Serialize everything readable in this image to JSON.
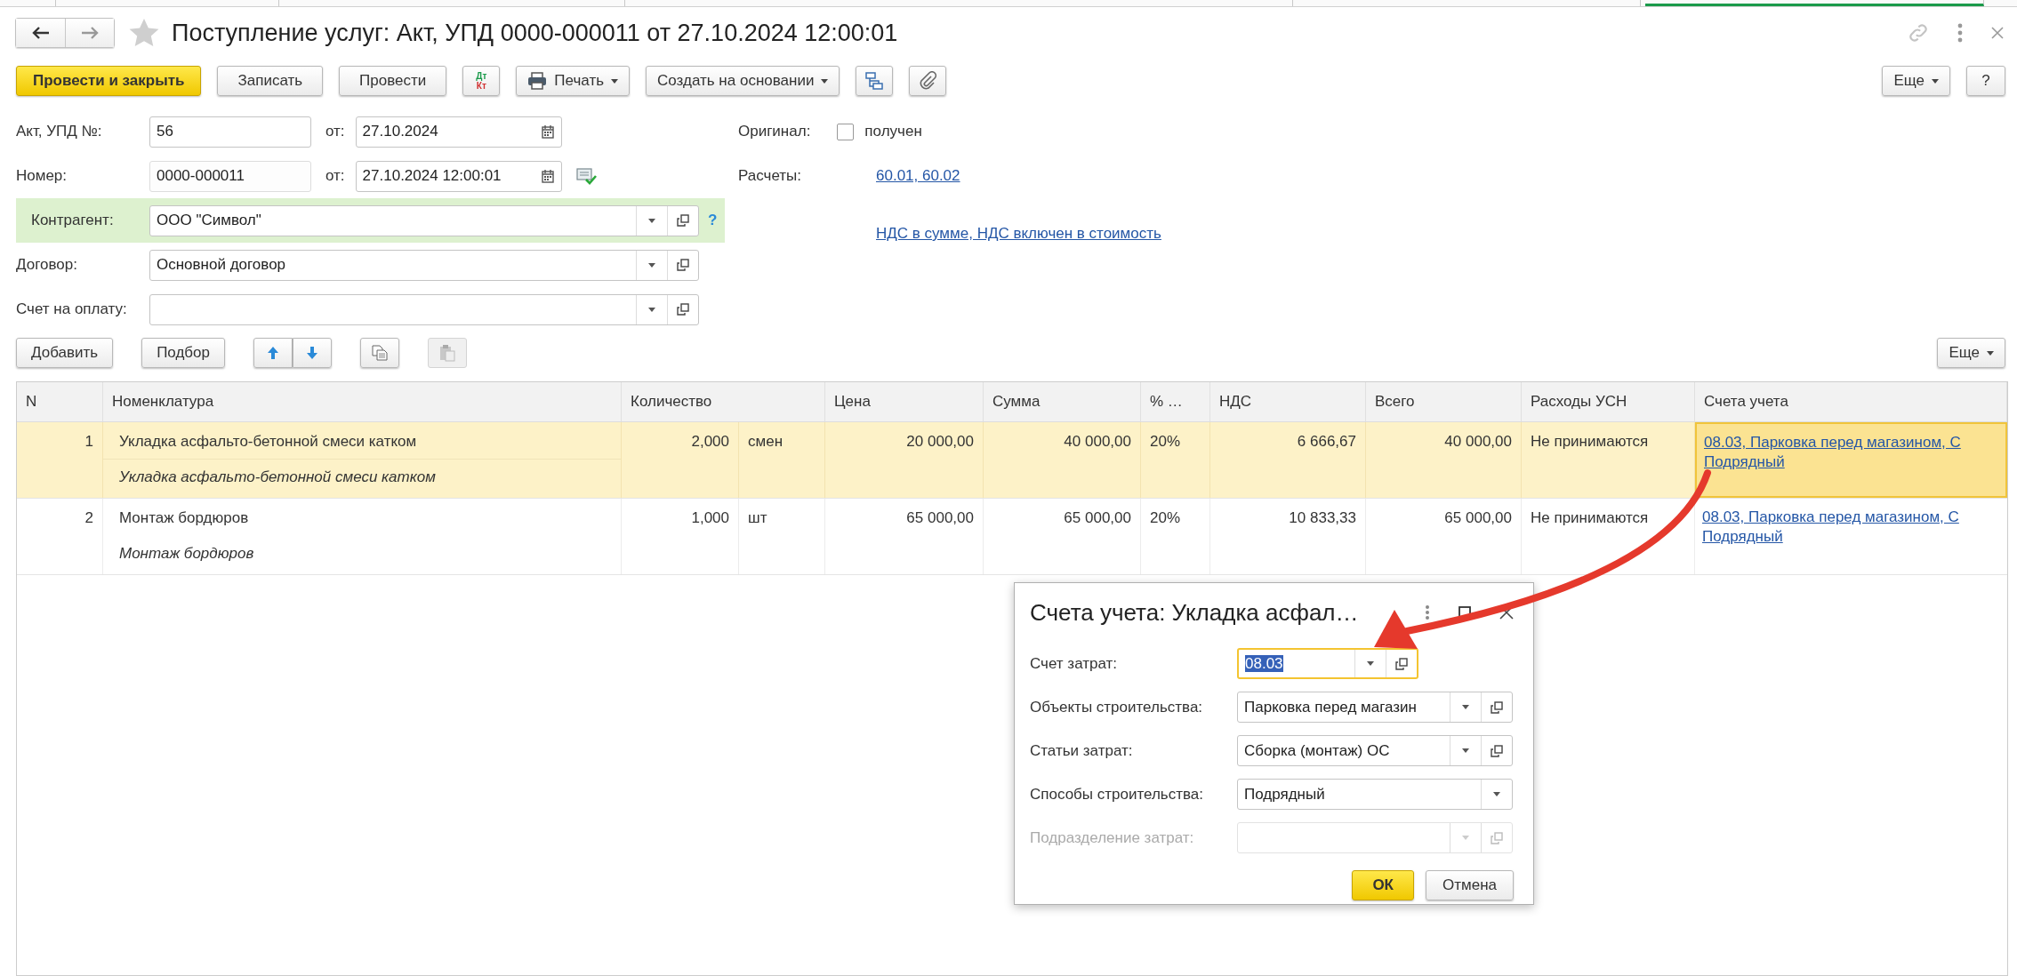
{
  "window": {
    "title": "Поступление услуг: Акт, УПД 0000-000011 от 27.10.2024 12:00:01",
    "favorite": false
  },
  "toolbar": {
    "items": [
      {
        "kind": "primary",
        "label": "Провести и закрыть"
      },
      {
        "kind": "button",
        "label": "Записать"
      },
      {
        "kind": "button",
        "label": "Провести"
      },
      {
        "kind": "dtkt",
        "label_top": "Дт",
        "label_bottom": "Кт"
      },
      {
        "kind": "print",
        "label": "Печать"
      },
      {
        "kind": "dropdown",
        "label": "Создать на основании"
      },
      {
        "kind": "structure"
      },
      {
        "kind": "attach"
      }
    ],
    "more": "Еще",
    "help": "?"
  },
  "form": {
    "act_number": {
      "label": "Акт, УПД №:",
      "value": "56",
      "date_label": "от:",
      "date": "27.10.2024"
    },
    "number": {
      "label": "Номер:",
      "value": "0000-000011",
      "date_label": "от:",
      "date": "27.10.2024 12:00:01"
    },
    "counterparty": {
      "label": "Контрагент:",
      "value": "ООО \"Символ\"",
      "help": "?"
    },
    "contract": {
      "label": "Договор:",
      "value": "Основной договор"
    },
    "invoice": {
      "label": "Счет на оплату:"
    },
    "original": {
      "label": "Оригинал:",
      "checkbox_label": "получен",
      "checked": false
    },
    "settlements": {
      "label": "Расчеты:",
      "link": "60.01, 60.02"
    },
    "vat_link": "НДС в сумме, НДС включен в стоимость"
  },
  "table_toolbar": {
    "buttons": [
      "Добавить",
      "Подбор"
    ],
    "icons": [
      {
        "kind": "up",
        "disabled": false
      },
      {
        "kind": "down",
        "disabled": false
      },
      {
        "kind": "copy",
        "disabled": false
      },
      {
        "kind": "paste",
        "disabled": true
      }
    ],
    "more": "Еще"
  },
  "table": {
    "columns": [
      "N",
      "Номенклатура",
      "Количество",
      "Цена",
      "Сумма",
      "% …",
      "НДС",
      "Всего",
      "Расходы УСН",
      "Счета учета"
    ],
    "rows": [
      {
        "n": "1",
        "name": "Укладка асфальто-бетонной смеси катком",
        "description": "Укладка асфальто-бетонной смеси катком",
        "quantity": "2,000",
        "unit": "смен",
        "price": "20 000,00",
        "sum": "40 000,00",
        "vat_rate": "20%",
        "vat": "6 666,67",
        "total": "40 000,00",
        "usn_expenses": "Не принимаются",
        "accounts": [
          "08.03, Парковка перед магазином, С",
          "Подрядный"
        ],
        "selected": true
      },
      {
        "n": "2",
        "name": "Монтаж бордюров",
        "description": "Монтаж бордюров",
        "quantity": "1,000",
        "unit": "шт",
        "price": "65 000,00",
        "sum": "65 000,00",
        "vat_rate": "20%",
        "vat": "10 833,33",
        "total": "65 000,00",
        "usn_expenses": "Не принимаются",
        "accounts": [
          "08.03, Парковка перед магазином, С",
          "Подрядный"
        ],
        "selected": false
      }
    ]
  },
  "dialog": {
    "title": "Счета учета: Укладка асфал…",
    "fields": [
      {
        "label": "Счет затрат:",
        "value": "08.03",
        "kind": "select-open",
        "focused": true,
        "disabled": false
      },
      {
        "label": "Объекты строительства:",
        "value": "Парковка перед магазин",
        "kind": "select-open",
        "focused": false,
        "disabled": false
      },
      {
        "label": "Статьи затрат:",
        "value": "Сборка (монтаж) ОС",
        "kind": "select-open",
        "focused": false,
        "disabled": false
      },
      {
        "label": "Способы строительства:",
        "value": "Подрядный",
        "kind": "select",
        "focused": false,
        "disabled": false
      },
      {
        "label": "Подразделение затрат:",
        "kind": "select-open",
        "focused": false,
        "disabled": true
      }
    ],
    "buttons": [
      {
        "label": "ОК",
        "kind": "primary"
      },
      {
        "label": "Отмена",
        "kind": "button"
      }
    ]
  }
}
